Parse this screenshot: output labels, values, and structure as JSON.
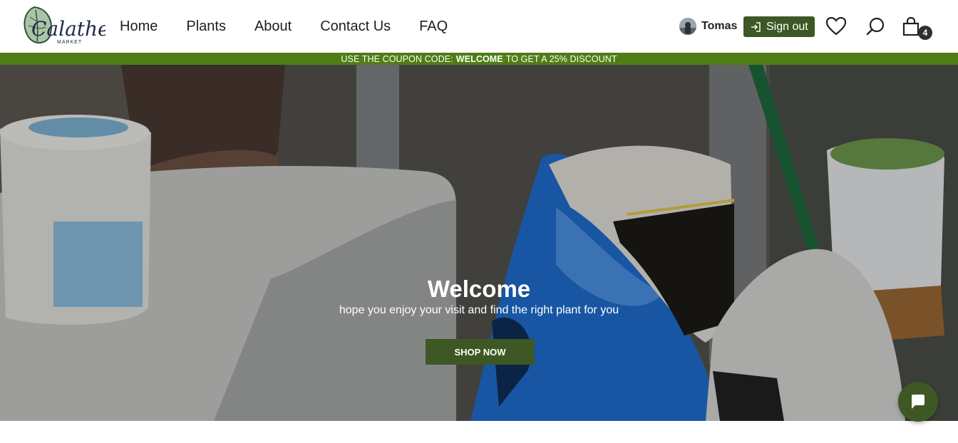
{
  "brand": {
    "logo_text": "Calathea",
    "logo_subtext": "MARKET"
  },
  "nav": {
    "items": [
      {
        "label": "Home"
      },
      {
        "label": "Plants"
      },
      {
        "label": "About"
      },
      {
        "label": "Contact Us"
      },
      {
        "label": "FAQ"
      }
    ]
  },
  "user": {
    "name": "Tomas",
    "sign_out_label": "Sign out"
  },
  "cart": {
    "count": "4"
  },
  "promo": {
    "prefix": "USE THE COUPON CODE:",
    "code": "WELCOME",
    "suffix": "TO GET A 25% DISCOUNT"
  },
  "hero": {
    "title": "Welcome",
    "subtitle": "hope you enjoy your visit and find the right plant for you",
    "cta_label": "SHOP NOW"
  },
  "colors": {
    "accent_dark_green": "#3d5824",
    "promo_green": "#4f7d16"
  },
  "icons": [
    "login-icon",
    "heart-icon",
    "search-icon",
    "shopping-bag-icon",
    "chat-icon"
  ]
}
